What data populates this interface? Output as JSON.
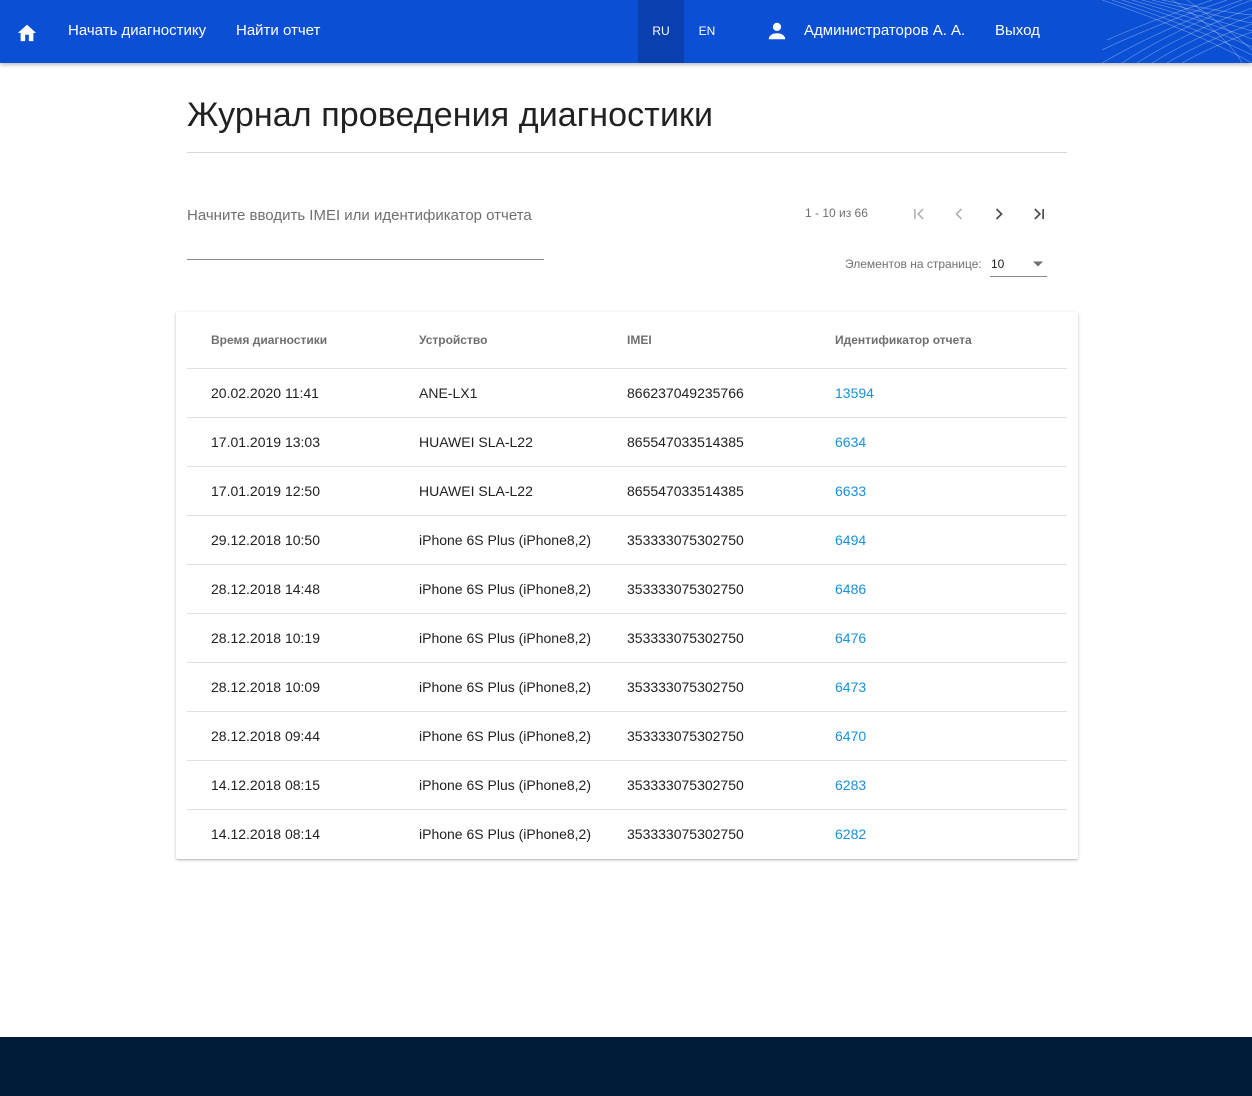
{
  "header": {
    "nav": {
      "start_diagnostics": "Начать диагностику",
      "find_report": "Найти отчет"
    },
    "languages": [
      {
        "code": "RU",
        "active": true
      },
      {
        "code": "EN",
        "active": false
      }
    ],
    "user_name": "Администраторов А. А.",
    "logout": "Выход",
    "icons": {
      "home": "home-icon",
      "user": "person-icon"
    },
    "colors": {
      "bar": "#0a4fd4",
      "active_lang": "#0a40ad"
    }
  },
  "page": {
    "title": "Журнал проведения диагностики"
  },
  "search": {
    "placeholder": "Начните вводить IMEI или идентификатор отчета",
    "value": ""
  },
  "paginator": {
    "range_label": "1 - 10 из 66",
    "items_per_page_label": "Элементов на странице:",
    "items_per_page_value": "10",
    "icons": [
      "first-page-icon",
      "previous-page-icon",
      "next-page-icon",
      "last-page-icon"
    ]
  },
  "table": {
    "columns": [
      "Время диагностики",
      "Устройство",
      "IMEI",
      "Идентификатор отчета"
    ],
    "rows": [
      {
        "time": "20.02.2020 11:41",
        "device": "ANE-LX1",
        "imei": "866237049235766",
        "report_id": "13594"
      },
      {
        "time": "17.01.2019 13:03",
        "device": "HUAWEI SLA-L22",
        "imei": "865547033514385",
        "report_id": "6634"
      },
      {
        "time": "17.01.2019 12:50",
        "device": "HUAWEI SLA-L22",
        "imei": "865547033514385",
        "report_id": "6633"
      },
      {
        "time": "29.12.2018 10:50",
        "device": "iPhone 6S Plus (iPhone8,2)",
        "imei": "353333075302750",
        "report_id": "6494"
      },
      {
        "time": "28.12.2018 14:48",
        "device": "iPhone 6S Plus (iPhone8,2)",
        "imei": "353333075302750",
        "report_id": "6486"
      },
      {
        "time": "28.12.2018 10:19",
        "device": "iPhone 6S Plus (iPhone8,2)",
        "imei": "353333075302750",
        "report_id": "6476"
      },
      {
        "time": "28.12.2018 10:09",
        "device": "iPhone 6S Plus (iPhone8,2)",
        "imei": "353333075302750",
        "report_id": "6473"
      },
      {
        "time": "28.12.2018 09:44",
        "device": "iPhone 6S Plus (iPhone8,2)",
        "imei": "353333075302750",
        "report_id": "6470"
      },
      {
        "time": "14.12.2018 08:15",
        "device": "iPhone 6S Plus (iPhone8,2)",
        "imei": "353333075302750",
        "report_id": "6283"
      },
      {
        "time": "14.12.2018 08:14",
        "device": "iPhone 6S Plus (iPhone8,2)",
        "imei": "353333075302750",
        "report_id": "6282"
      }
    ],
    "link_color": "#1a8fdc"
  },
  "footer": {
    "color": "#011c38"
  }
}
